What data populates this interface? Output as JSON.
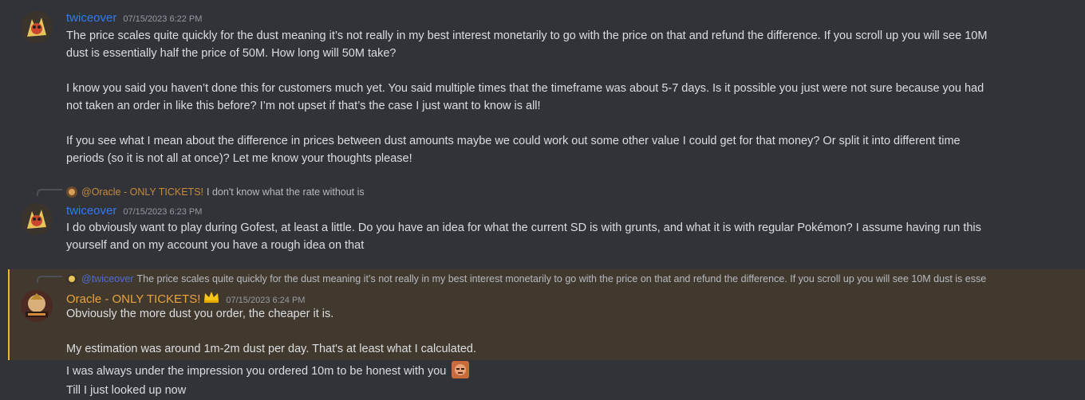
{
  "messages": [
    {
      "username": "twiceover",
      "timestamp": "07/15/2023 6:22 PM",
      "lines": [
        "The price scales quite quickly for the dust meaning it’s not really in my best interest monetarily to go with the price on that and refund the difference. If you scroll up you will see 10M",
        "dust is essentially half the price of 50M. How long will 50M take?",
        "I know you said you haven’t done this for customers much yet. You said multiple times that the timeframe was about 5-7 days. Is it possible you just were not sure because you had",
        "not taken an order in like this before? I’m not upset if that’s the case I just want to know is all!",
        "If you see what I mean about the difference in prices between dust amounts maybe we could work out some other value I could get for that money? Or split it into different time",
        "periods (so it is not all at once)? Let me know your thoughts please!"
      ]
    },
    {
      "reply_mention": "@Oracle - ONLY TICKETS!",
      "reply_text": "I don't know what the rate without is",
      "username": "twiceover",
      "timestamp": "07/15/2023 6:23 PM",
      "lines": [
        "I do obviously want to play during Gofest, at least a little. Do you have an idea for what the current SD is with grunts, and what it is with regular Pokémon? I assume having run this",
        "yourself and on my account you have a rough idea on that"
      ]
    },
    {
      "reply_mention": "@twiceover",
      "reply_text": "The price scales quite quickly for the dust meaning it’s not really in my best interest monetarily to go with the price on that and refund the difference. If you scroll up you will see 10M dust is esse",
      "username": "Oracle - ONLY TICKETS!",
      "timestamp": "07/15/2023 6:24 PM",
      "lines": [
        "Obviously the more dust you order, the cheaper it is.",
        "My estimation was around 1m-2m dust per day. That's at least what I calculated.",
        "I was always under the impression you ordered 10m to be honest with you",
        "Till I just looked up now"
      ]
    }
  ],
  "colors": {
    "background": "#313338",
    "highlight": "#42392e",
    "highlight_border": "#f0b232",
    "username_blue": "#2f7bf5",
    "username_orange": "#e8a33d"
  }
}
